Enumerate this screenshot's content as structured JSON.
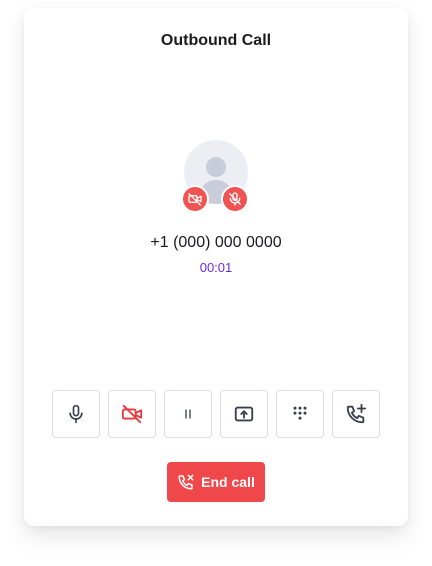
{
  "dialog": {
    "title": "Outbound Call"
  },
  "caller": {
    "phone_number": "+1 (000) 000 0000",
    "duration": "00:01",
    "avatar_icon": "person-icon",
    "video_status_icon": "video-off-icon",
    "mic_status_icon": "mic-off-icon"
  },
  "controls": [
    {
      "name": "mute-button",
      "icon": "microphone-icon"
    },
    {
      "name": "video-toggle-button",
      "icon": "video-off-icon"
    },
    {
      "name": "hold-button",
      "icon": "pause-icon"
    },
    {
      "name": "share-screen-button",
      "icon": "screen-share-icon"
    },
    {
      "name": "dialpad-button",
      "icon": "dialpad-icon"
    },
    {
      "name": "add-call-button",
      "icon": "phone-add-icon"
    }
  ],
  "end_call": {
    "label": "End call",
    "icon": "phone-hangup-icon"
  },
  "colors": {
    "accent": "#6b2bd9",
    "danger": "#f0474b",
    "badge": "#f15252",
    "icon": "#3a3f4b"
  }
}
